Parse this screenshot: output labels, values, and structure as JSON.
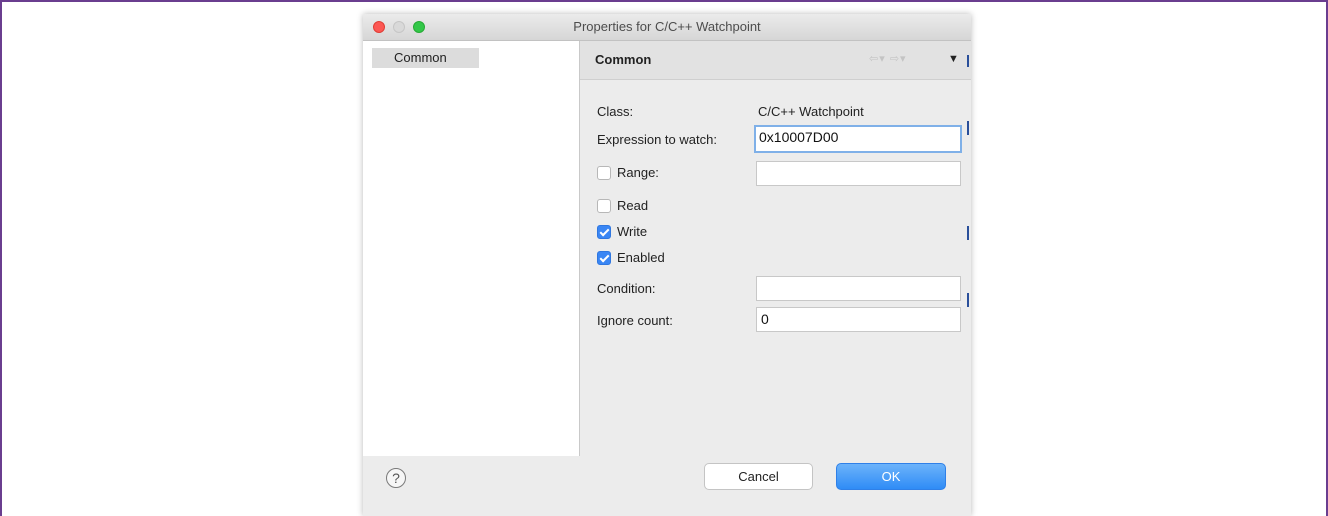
{
  "window": {
    "title": "Properties for C/C++ Watchpoint"
  },
  "sidebar": {
    "items": [
      {
        "label": "Common",
        "selected": true
      }
    ]
  },
  "page": {
    "header": "Common",
    "nav": {
      "back": "⇦▾",
      "forward": "⇨▾",
      "menu": "▼"
    },
    "class_label": "Class:",
    "class_value": "C/C++ Watchpoint",
    "expression_label": "Expression to watch:",
    "expression_value": "0x10007D00",
    "range_label": "Range:",
    "range_checked": false,
    "range_value": "",
    "read_label": "Read",
    "read_checked": false,
    "write_label": "Write",
    "write_checked": true,
    "enabled_label": "Enabled",
    "enabled_checked": true,
    "condition_label": "Condition:",
    "condition_value": "",
    "ignore_count_label": "Ignore count:",
    "ignore_count_value": "0"
  },
  "footer": {
    "help": "?",
    "cancel_label": "Cancel",
    "ok_label": "OK"
  },
  "colors": {
    "accent": "#3a86f4",
    "ok_button": "#2f8cf6",
    "frame": "#6a3d8f"
  }
}
